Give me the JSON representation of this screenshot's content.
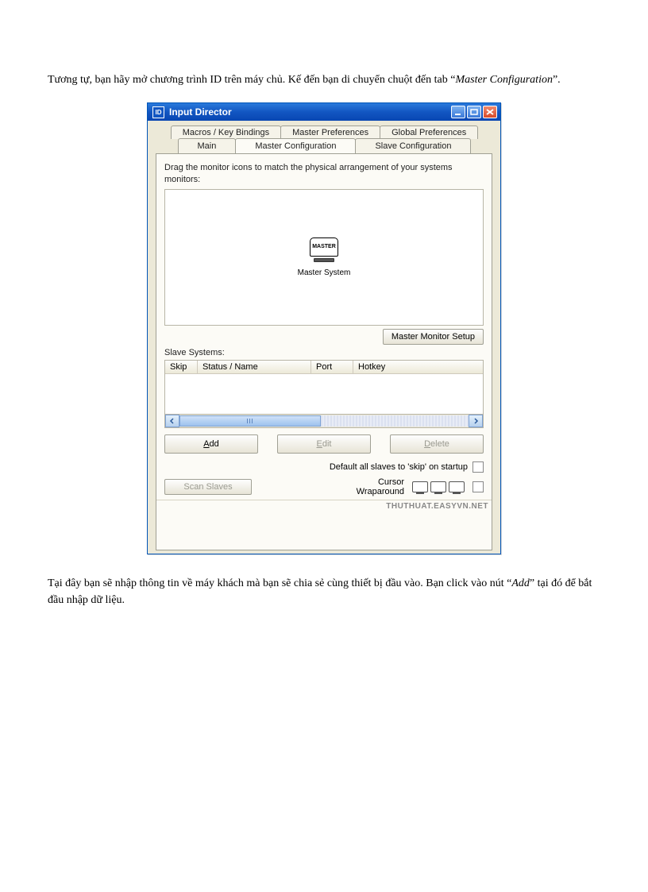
{
  "doc": {
    "para1_pre": "Tương tự, bạn hãy mở chương trình  ID trên máy chủ. Kế đến bạn di chuyển  chuột  đến tab “",
    "para1_em": "Master Configuration",
    "para1_post": "”.",
    "para2_pre": "Tại đây bạn sẽ nhập thông tin về máy khách mà bạn sẽ chia sẻ cùng thiết  bị đầu vào. Bạn click vào nút “",
    "para2_em": "Add",
    "para2_post": "” tại đó để bắt đầu nhập  dữ liệu."
  },
  "window": {
    "id_icon": "ID",
    "title": "Input Director",
    "tabs_row1": [
      "Macros / Key Bindings",
      "Master Preferences",
      "Global Preferences"
    ],
    "tabs_row2": [
      "Main",
      "Master Configuration",
      "Slave Configuration"
    ],
    "active_tab": "Master Configuration",
    "instructions": "Drag the monitor icons to match the physical arrangement of your systems monitors:",
    "monitor_label_inner": "MASTER",
    "monitor_caption": "Master System",
    "master_monitor_setup_btn": "Master Monitor Setup",
    "slave_systems_label": "Slave Systems:",
    "columns": {
      "skip": "Skip",
      "status_name": "Status / Name",
      "port": "Port",
      "hotkey": "Hotkey"
    },
    "buttons": {
      "add_u": "A",
      "add_rest": "dd",
      "edit_u": "E",
      "edit_rest": "dit",
      "delete_u": "D",
      "delete_rest": "elete",
      "scan": "Scan Slaves"
    },
    "default_skip_label": "Default all slaves to 'skip' on startup",
    "cursor_label_line1": "Cursor",
    "cursor_label_line2": "Wraparound",
    "watermark": "THUTHUAT.EASYVN.NET"
  }
}
